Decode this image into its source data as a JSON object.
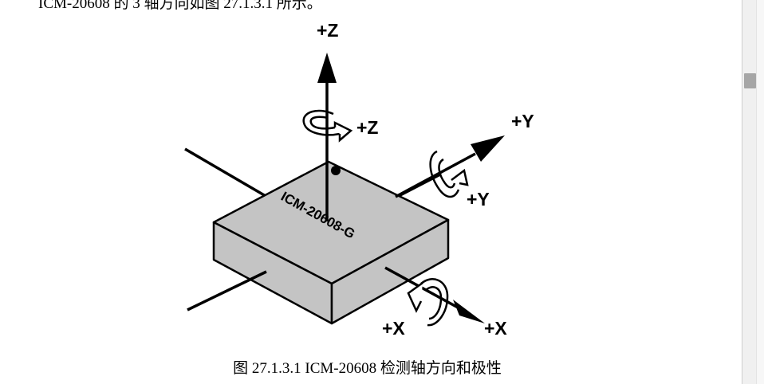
{
  "document": {
    "top_text": "ICM-20608 的 3 轴方向如图 27.1.3.1 所示。",
    "caption": "图 27.1.3.1 ICM-20608 检测轴方向和极性"
  },
  "figure": {
    "chip_label": "ICM-20608-G",
    "axis_labels": {
      "z_axis": "+Z",
      "z_rotation": "+Z",
      "y_axis": "+Y",
      "y_rotation": "+Y",
      "x_rotation": "+X",
      "x_axis": "+X"
    },
    "chip_color": "#c4c4c4"
  },
  "scrollbar": {
    "thumb_color": "#a6a6a6"
  }
}
